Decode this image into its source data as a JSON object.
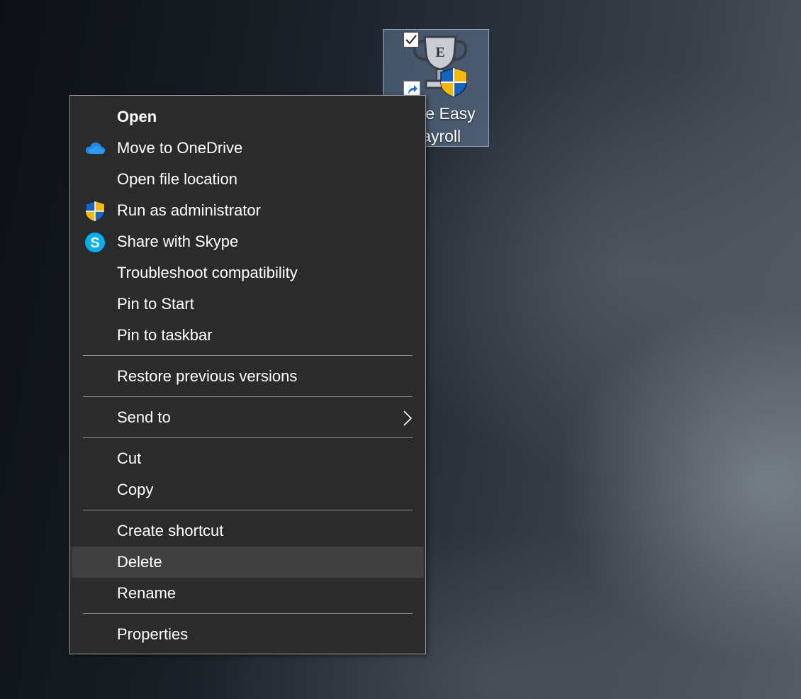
{
  "desktop_icon": {
    "label": "Sage Easy\nPayroll",
    "checked": true,
    "badge_icon": "uac-shield-icon",
    "overlay_icon": "shortcut-arrow-icon"
  },
  "context_menu": {
    "hovered_item": "Delete",
    "items": [
      {
        "label": "Open",
        "bold": true
      },
      {
        "label": "Move to OneDrive",
        "icon": "onedrive-cloud-icon"
      },
      {
        "label": "Open file location"
      },
      {
        "label": "Run as administrator",
        "icon": "uac-shield-icon"
      },
      {
        "label": "Share with Skype",
        "icon": "skype-icon"
      },
      {
        "label": "Troubleshoot compatibility"
      },
      {
        "label": "Pin to Start"
      },
      {
        "label": "Pin to taskbar"
      },
      {
        "label": "Restore previous versions"
      },
      {
        "label": "Send to",
        "icon": "chevron-right-icon"
      },
      {
        "label": "Cut"
      },
      {
        "label": "Copy"
      },
      {
        "label": "Create shortcut"
      },
      {
        "label": "Delete"
      },
      {
        "label": "Rename"
      },
      {
        "label": "Properties"
      }
    ]
  },
  "colors": {
    "menu_background": "#2b2b2b",
    "menu_hover": "#414141",
    "menu_border": "#a0a0a0",
    "separator": "#8a8a8a",
    "selection_highlight": "#7896b9",
    "onedrive_blue": "#1e88e5",
    "skype_blue": "#00aff0",
    "shield_blue": "#1565c0",
    "shield_yellow": "#f9b800"
  }
}
